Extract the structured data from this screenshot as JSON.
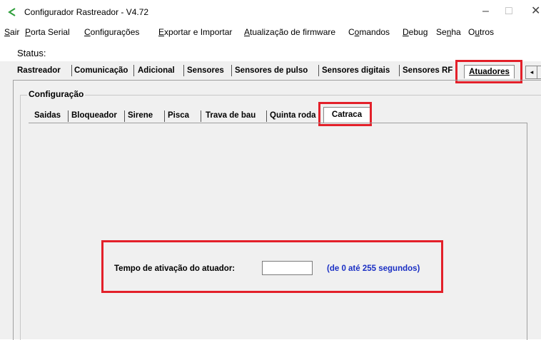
{
  "window": {
    "title": "Configurador Rastreador - V4.72",
    "app_icon": "chevron-logo-icon",
    "accent_color": "#2e9e3a",
    "controls": {
      "minimize": "–",
      "maximize": "□",
      "close": "✕"
    }
  },
  "menubar": {
    "items": [
      {
        "ul": "S",
        "rest": "air"
      },
      {
        "ul": "P",
        "rest": "orta Serial"
      },
      {
        "ul": "C",
        "rest": "onfigurações"
      },
      {
        "ul": "E",
        "rest": "xportar e Importar"
      },
      {
        "ul": "A",
        "rest": "tualização de firmware"
      },
      {
        "pre": "C",
        "ul": "o",
        "rest": "mandos"
      },
      {
        "ul": "D",
        "rest": "ebug"
      },
      {
        "pre": "Se",
        "ul": "n",
        "rest": "ha"
      },
      {
        "pre": "O",
        "ul": "u",
        "rest": "tros"
      }
    ]
  },
  "status": {
    "label": "Status:"
  },
  "main_tabs": {
    "items": [
      "Rastreador",
      "Comunicação",
      "Adicional",
      "Sensores",
      "Sensores de pulso",
      "Sensores digitais",
      "Sensores RF"
    ],
    "active": "Atuadores",
    "scroll_left": "◂"
  },
  "config_group": {
    "label": "Configuração"
  },
  "sub_tabs": {
    "items": [
      "Saidas",
      "Bloqueador",
      "Sirene",
      "Pisca",
      "Trava de bau",
      "Quinta roda"
    ],
    "active": "Catraca"
  },
  "catraca": {
    "field_label": "Tempo de ativação do atuador:",
    "field_value": "",
    "field_hint": "(de 0 até 255 segundos)"
  },
  "highlight_color": "#e3202a",
  "hint_color": "#1a2fc4"
}
